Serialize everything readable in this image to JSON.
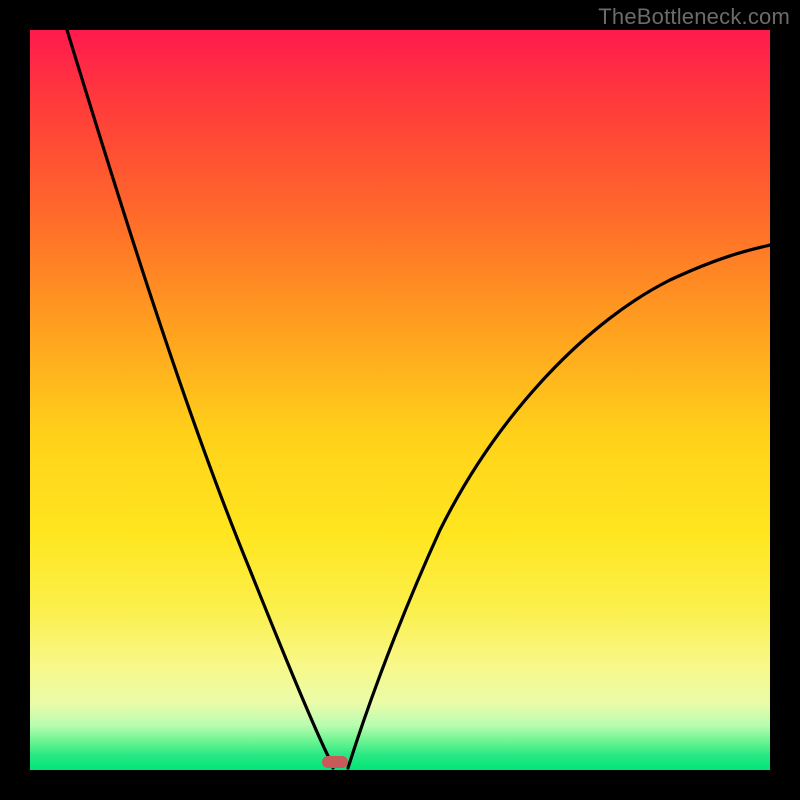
{
  "watermark": "TheBottleneck.com",
  "colors": {
    "background": "#000000",
    "curve": "#000000",
    "marker": "#c85a5a",
    "gradient_top": "#ff1a4d",
    "gradient_bottom": "#00e676"
  },
  "chart_data": {
    "type": "line",
    "title": "",
    "xlabel": "",
    "ylabel": "",
    "xlim": [
      0,
      100
    ],
    "ylim": [
      0,
      100
    ],
    "grid": false,
    "legend": false,
    "series": [
      {
        "name": "left-branch",
        "x": [
          5,
          10,
          15,
          20,
          25,
          30,
          35,
          38,
          40,
          41
        ],
        "y": [
          100,
          84,
          68,
          53,
          39,
          26,
          14,
          6,
          1,
          0
        ]
      },
      {
        "name": "right-branch",
        "x": [
          43,
          45,
          48,
          52,
          58,
          65,
          73,
          82,
          92,
          100
        ],
        "y": [
          0,
          3,
          9,
          18,
          29,
          40,
          49,
          57,
          64,
          69
        ]
      }
    ],
    "marker": {
      "x": 41,
      "y": 0
    },
    "annotations": []
  }
}
